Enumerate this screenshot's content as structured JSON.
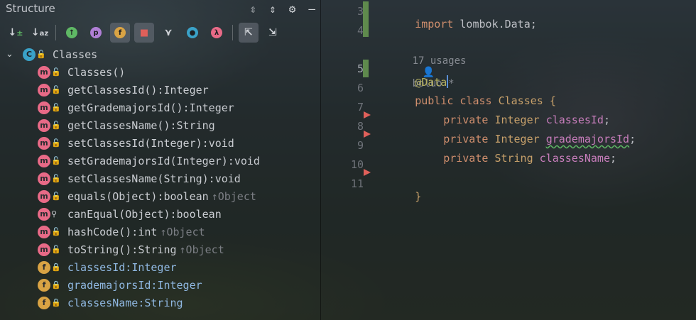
{
  "structure": {
    "title": "Structure",
    "title_actions": [
      "expand-all-icon",
      "collapse-all-icon",
      "gear-icon",
      "minimize-icon"
    ],
    "toolbar": [
      {
        "name": "sort-by-visibility",
        "glyph": "↓±"
      },
      {
        "name": "sort-alphabetically",
        "glyph": "↓ᵃz"
      },
      {
        "name": "show-inherited",
        "glyph": "↑"
      },
      {
        "name": "show-properties",
        "glyph": "p"
      },
      {
        "name": "show-fields",
        "glyph": "f"
      },
      {
        "name": "show-non-public",
        "glyph": "🔒"
      },
      {
        "name": "show-lambdas-tree",
        "glyph": "⋎"
      },
      {
        "name": "show-anonymous",
        "glyph": "◉"
      },
      {
        "name": "show-lambdas",
        "glyph": "λ"
      },
      {
        "name": "autoscroll-to-source",
        "glyph": "⇱"
      },
      {
        "name": "autoscroll-from-source",
        "glyph": "⇲"
      }
    ],
    "root": {
      "label": "Classes",
      "icon": "C"
    },
    "members": [
      {
        "kind": "m",
        "vis": "pub",
        "name": "Classes()",
        "type": "",
        "owner": ""
      },
      {
        "kind": "m",
        "vis": "pub",
        "name": "getClassesId(): ",
        "type": "Integer",
        "owner": ""
      },
      {
        "kind": "m",
        "vis": "pub",
        "name": "getGrademajorsId(): ",
        "type": "Integer",
        "owner": ""
      },
      {
        "kind": "m",
        "vis": "pub",
        "name": "getClassesName(): ",
        "type": "String",
        "owner": ""
      },
      {
        "kind": "m",
        "vis": "pub",
        "name": "setClassesId(Integer): ",
        "type": "void",
        "owner": ""
      },
      {
        "kind": "m",
        "vis": "pub",
        "name": "setGrademajorsId(Integer): ",
        "type": "void",
        "owner": ""
      },
      {
        "kind": "m",
        "vis": "pub",
        "name": "setClassesName(String): ",
        "type": "void",
        "owner": ""
      },
      {
        "kind": "m",
        "vis": "pub",
        "name": "equals(Object): ",
        "type": "boolean",
        "owner": "↑Object"
      },
      {
        "kind": "m",
        "vis": "pkg",
        "name": "canEqual(Object): ",
        "type": "boolean",
        "owner": ""
      },
      {
        "kind": "m",
        "vis": "pub",
        "name": "hashCode(): ",
        "type": "int",
        "owner": "↑Object"
      },
      {
        "kind": "m",
        "vis": "pub",
        "name": "toString(): ",
        "type": "String",
        "owner": "↑Object"
      },
      {
        "kind": "f",
        "vis": "priv",
        "name": "classesId: ",
        "type": "Integer",
        "owner": ""
      },
      {
        "kind": "f",
        "vis": "priv",
        "name": "grademajorsId: ",
        "type": "Integer",
        "owner": ""
      },
      {
        "kind": "f",
        "vis": "priv",
        "name": "classesName: ",
        "type": "String",
        "owner": ""
      }
    ]
  },
  "editor": {
    "line_numbers": [
      "3",
      "4",
      "",
      "5",
      "6",
      "7",
      "8",
      "9",
      "10",
      "11"
    ],
    "usage_hint": "17 usages",
    "author_hint": "boluo *",
    "lines": {
      "import": "import",
      "import_pkg": " lombok.Data;",
      "annotation": "@Data",
      "public": "public",
      "class": " class",
      "classname": " Classes",
      "open_brace": " {",
      "private": "private",
      "integer": "Integer",
      "string": "String",
      "f1": "classesId",
      "f2": "grademajorsId",
      "f3": "classesName",
      "semi": ";",
      "close_brace": "}"
    },
    "colors": {
      "keyword": "#cf8e6d",
      "field": "#c77dbb",
      "annotation": "#b3ae60",
      "caret": "#5b8fd6"
    }
  }
}
